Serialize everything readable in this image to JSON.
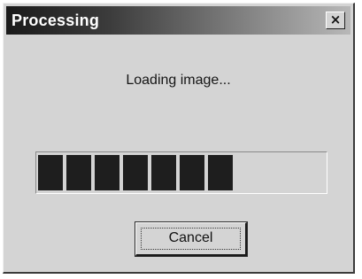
{
  "window": {
    "title": "Processing",
    "close_label": "×"
  },
  "message": "Loading image...",
  "progress": {
    "filled_blocks": 7,
    "total_blocks": 10,
    "fraction": 0.7
  },
  "buttons": {
    "cancel_label": "Cancel"
  },
  "colors": {
    "dialog_face": "#d4d4d4",
    "progress_fill": "#1e1e1e",
    "title_text": "#ffffff"
  }
}
